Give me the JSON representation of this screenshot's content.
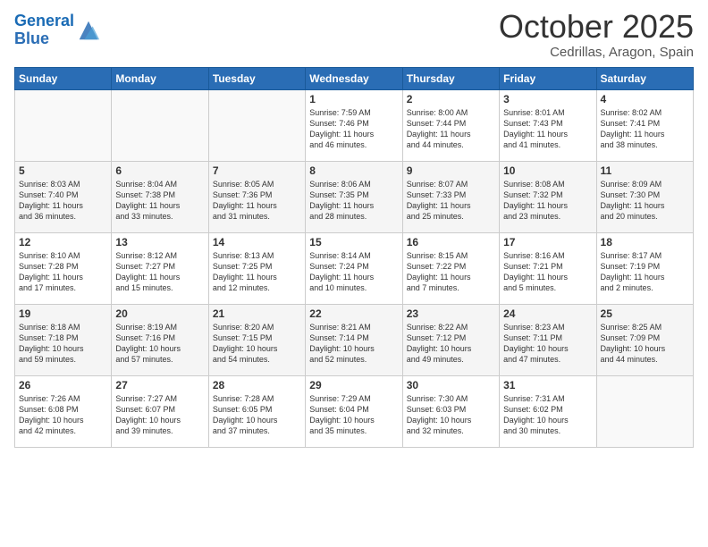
{
  "header": {
    "logo_line1": "General",
    "logo_line2": "Blue",
    "month": "October 2025",
    "location": "Cedrillas, Aragon, Spain"
  },
  "weekdays": [
    "Sunday",
    "Monday",
    "Tuesday",
    "Wednesday",
    "Thursday",
    "Friday",
    "Saturday"
  ],
  "weeks": [
    [
      {
        "day": "",
        "info": ""
      },
      {
        "day": "",
        "info": ""
      },
      {
        "day": "",
        "info": ""
      },
      {
        "day": "1",
        "info": "Sunrise: 7:59 AM\nSunset: 7:46 PM\nDaylight: 11 hours\nand 46 minutes."
      },
      {
        "day": "2",
        "info": "Sunrise: 8:00 AM\nSunset: 7:44 PM\nDaylight: 11 hours\nand 44 minutes."
      },
      {
        "day": "3",
        "info": "Sunrise: 8:01 AM\nSunset: 7:43 PM\nDaylight: 11 hours\nand 41 minutes."
      },
      {
        "day": "4",
        "info": "Sunrise: 8:02 AM\nSunset: 7:41 PM\nDaylight: 11 hours\nand 38 minutes."
      }
    ],
    [
      {
        "day": "5",
        "info": "Sunrise: 8:03 AM\nSunset: 7:40 PM\nDaylight: 11 hours\nand 36 minutes."
      },
      {
        "day": "6",
        "info": "Sunrise: 8:04 AM\nSunset: 7:38 PM\nDaylight: 11 hours\nand 33 minutes."
      },
      {
        "day": "7",
        "info": "Sunrise: 8:05 AM\nSunset: 7:36 PM\nDaylight: 11 hours\nand 31 minutes."
      },
      {
        "day": "8",
        "info": "Sunrise: 8:06 AM\nSunset: 7:35 PM\nDaylight: 11 hours\nand 28 minutes."
      },
      {
        "day": "9",
        "info": "Sunrise: 8:07 AM\nSunset: 7:33 PM\nDaylight: 11 hours\nand 25 minutes."
      },
      {
        "day": "10",
        "info": "Sunrise: 8:08 AM\nSunset: 7:32 PM\nDaylight: 11 hours\nand 23 minutes."
      },
      {
        "day": "11",
        "info": "Sunrise: 8:09 AM\nSunset: 7:30 PM\nDaylight: 11 hours\nand 20 minutes."
      }
    ],
    [
      {
        "day": "12",
        "info": "Sunrise: 8:10 AM\nSunset: 7:28 PM\nDaylight: 11 hours\nand 17 minutes."
      },
      {
        "day": "13",
        "info": "Sunrise: 8:12 AM\nSunset: 7:27 PM\nDaylight: 11 hours\nand 15 minutes."
      },
      {
        "day": "14",
        "info": "Sunrise: 8:13 AM\nSunset: 7:25 PM\nDaylight: 11 hours\nand 12 minutes."
      },
      {
        "day": "15",
        "info": "Sunrise: 8:14 AM\nSunset: 7:24 PM\nDaylight: 11 hours\nand 10 minutes."
      },
      {
        "day": "16",
        "info": "Sunrise: 8:15 AM\nSunset: 7:22 PM\nDaylight: 11 hours\nand 7 minutes."
      },
      {
        "day": "17",
        "info": "Sunrise: 8:16 AM\nSunset: 7:21 PM\nDaylight: 11 hours\nand 5 minutes."
      },
      {
        "day": "18",
        "info": "Sunrise: 8:17 AM\nSunset: 7:19 PM\nDaylight: 11 hours\nand 2 minutes."
      }
    ],
    [
      {
        "day": "19",
        "info": "Sunrise: 8:18 AM\nSunset: 7:18 PM\nDaylight: 10 hours\nand 59 minutes."
      },
      {
        "day": "20",
        "info": "Sunrise: 8:19 AM\nSunset: 7:16 PM\nDaylight: 10 hours\nand 57 minutes."
      },
      {
        "day": "21",
        "info": "Sunrise: 8:20 AM\nSunset: 7:15 PM\nDaylight: 10 hours\nand 54 minutes."
      },
      {
        "day": "22",
        "info": "Sunrise: 8:21 AM\nSunset: 7:14 PM\nDaylight: 10 hours\nand 52 minutes."
      },
      {
        "day": "23",
        "info": "Sunrise: 8:22 AM\nSunset: 7:12 PM\nDaylight: 10 hours\nand 49 minutes."
      },
      {
        "day": "24",
        "info": "Sunrise: 8:23 AM\nSunset: 7:11 PM\nDaylight: 10 hours\nand 47 minutes."
      },
      {
        "day": "25",
        "info": "Sunrise: 8:25 AM\nSunset: 7:09 PM\nDaylight: 10 hours\nand 44 minutes."
      }
    ],
    [
      {
        "day": "26",
        "info": "Sunrise: 7:26 AM\nSunset: 6:08 PM\nDaylight: 10 hours\nand 42 minutes."
      },
      {
        "day": "27",
        "info": "Sunrise: 7:27 AM\nSunset: 6:07 PM\nDaylight: 10 hours\nand 39 minutes."
      },
      {
        "day": "28",
        "info": "Sunrise: 7:28 AM\nSunset: 6:05 PM\nDaylight: 10 hours\nand 37 minutes."
      },
      {
        "day": "29",
        "info": "Sunrise: 7:29 AM\nSunset: 6:04 PM\nDaylight: 10 hours\nand 35 minutes."
      },
      {
        "day": "30",
        "info": "Sunrise: 7:30 AM\nSunset: 6:03 PM\nDaylight: 10 hours\nand 32 minutes."
      },
      {
        "day": "31",
        "info": "Sunrise: 7:31 AM\nSunset: 6:02 PM\nDaylight: 10 hours\nand 30 minutes."
      },
      {
        "day": "",
        "info": ""
      }
    ]
  ]
}
